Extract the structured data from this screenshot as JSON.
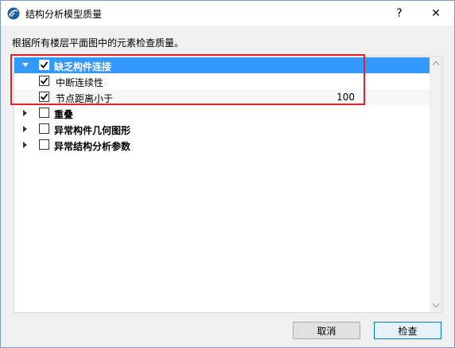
{
  "window": {
    "title": "结构分析模型质量",
    "help_label": "?",
    "close_label": "✕"
  },
  "instruction": "根据所有楼层平面图中的元素检查质量。",
  "tree": {
    "groups": [
      {
        "label": "缺乏构件连接",
        "checked": true,
        "expanded": true,
        "selected": true,
        "children": [
          {
            "label": "中断连续性",
            "checked": true,
            "value": ""
          },
          {
            "label": "节点距离小于",
            "checked": true,
            "value": "100"
          }
        ]
      },
      {
        "label": "重叠",
        "checked": false,
        "expanded": false
      },
      {
        "label": "异常构件几何图形",
        "checked": false,
        "expanded": false
      },
      {
        "label": "异常结构分析参数",
        "checked": false,
        "expanded": false
      }
    ]
  },
  "buttons": {
    "cancel": "取消",
    "check": "检查"
  },
  "colors": {
    "selection": "#3399ff",
    "highlight_box": "#e8202a",
    "title_bar": "#ffffff"
  }
}
